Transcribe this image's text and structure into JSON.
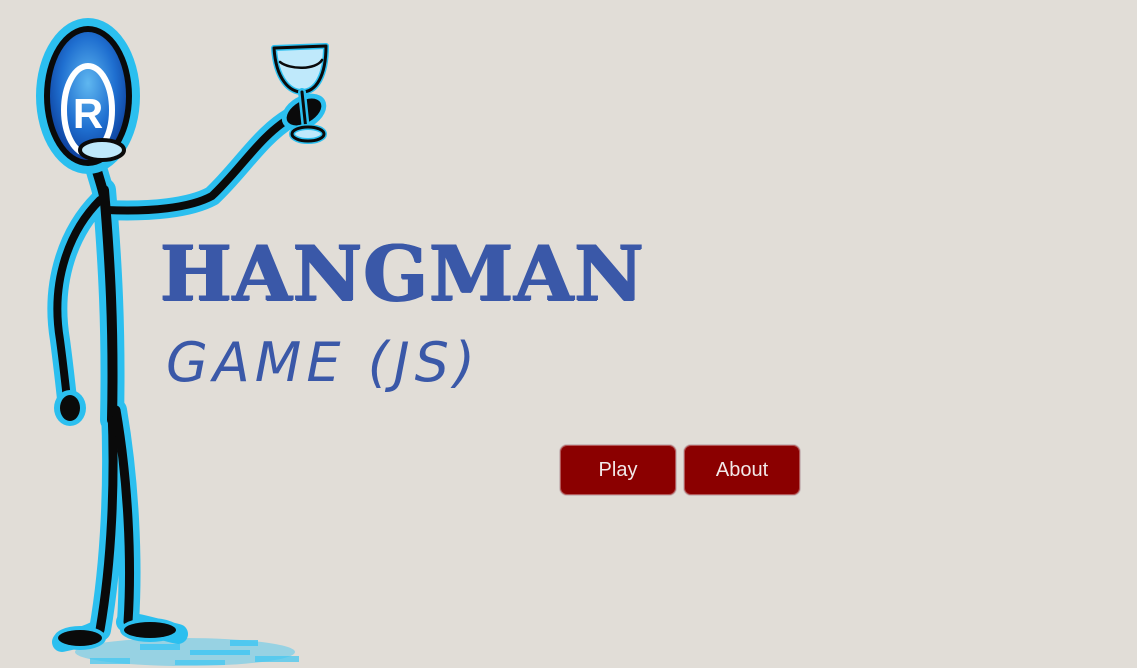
{
  "game": {
    "title": "HANGMAN",
    "subtitle": "GAME (JS)"
  },
  "menu": {
    "play_label": "Play",
    "about_label": "About"
  },
  "figure": {
    "head_mark": "R",
    "icon": "stick-figure-toasting-icon"
  },
  "colors": {
    "background": "#e1ddd7",
    "title": "#3a58a8",
    "button": "#8b0000",
    "button_text": "#f2e8e8",
    "glow": "#2bbfef"
  }
}
